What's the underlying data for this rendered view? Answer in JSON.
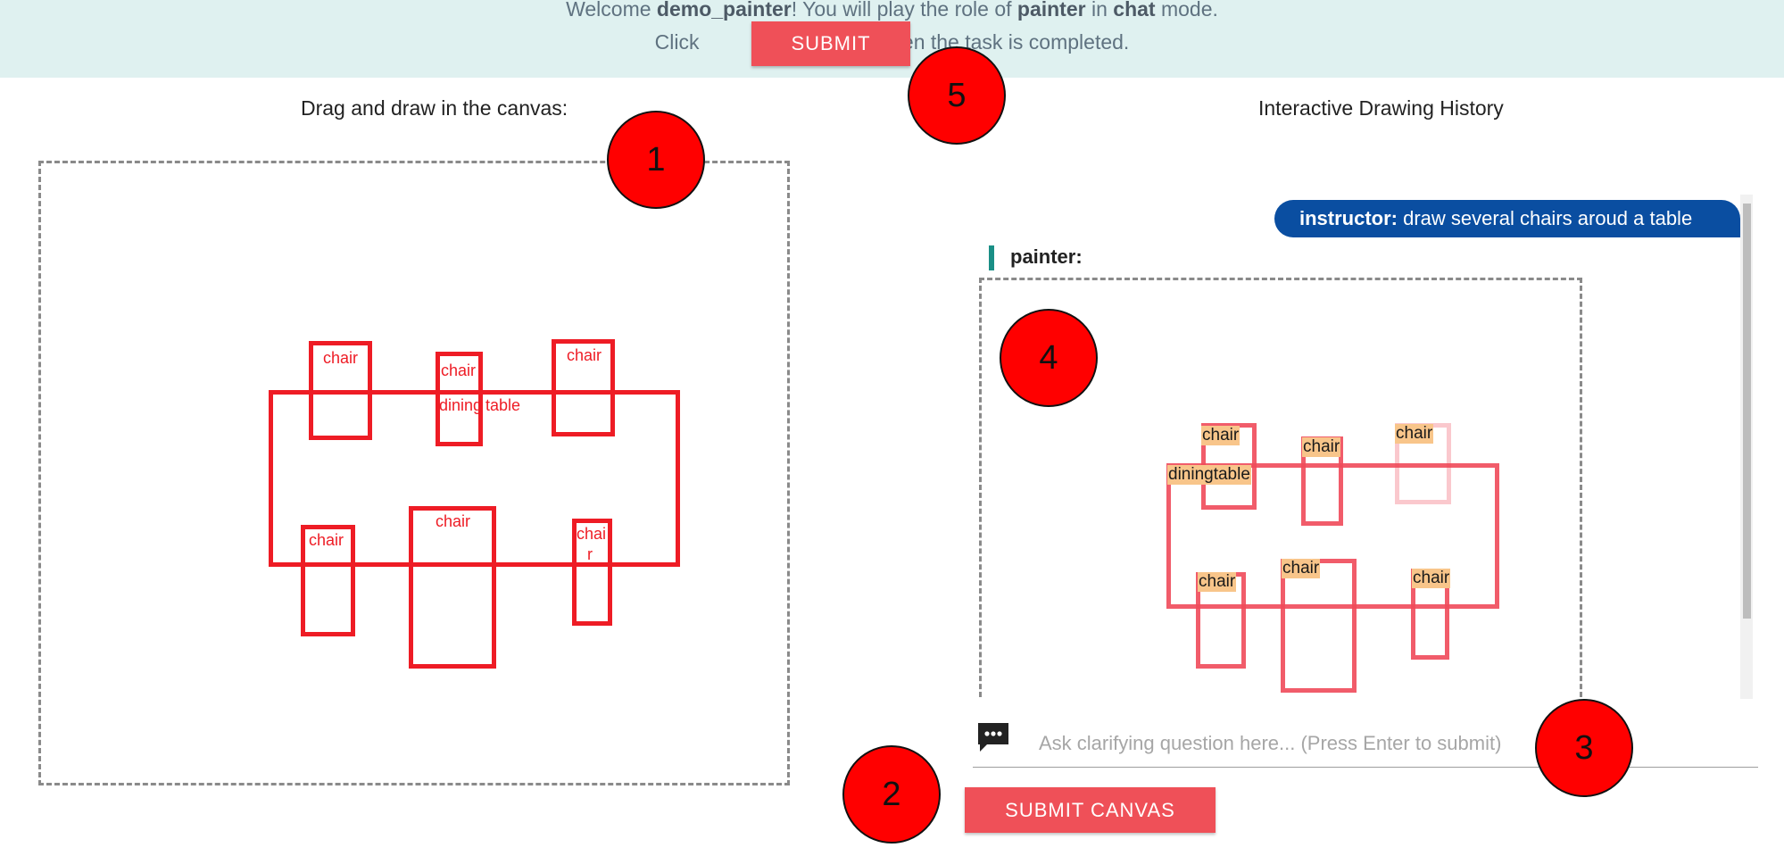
{
  "banner": {
    "welcome_prefix": "Welcome ",
    "username": "demo_painter",
    "role_prefix": "! You will play the role of ",
    "role": "painter",
    "mode_prefix": " in ",
    "mode": "chat",
    "mode_suffix": " mode.",
    "click_label": "Click",
    "submit_label": "SUBMIT",
    "completed_label": "when the task is completed."
  },
  "canvas": {
    "heading": "Drag and draw in the canvas:",
    "labels": [
      "chair",
      "chair",
      "dining",
      "table",
      "chair",
      "chair",
      "chair",
      "chai",
      "r"
    ]
  },
  "history": {
    "heading": "Interactive Drawing History",
    "instructor_name": "instructor:",
    "instructor_message": "draw several chairs aroud a table",
    "painter_name": "painter:",
    "labels": [
      "chair",
      "chair",
      "chair",
      "diningtable",
      "chair",
      "chair",
      "chair"
    ]
  },
  "chat_input": {
    "placeholder": "Ask clarifying question here... (Press Enter to submit)",
    "icon": "chat-bubble-icon"
  },
  "submit_canvas_label": "SUBMIT CANVAS",
  "markers": [
    "1",
    "2",
    "3",
    "4",
    "5"
  ],
  "colors": {
    "banner_bg": "#dff1f0",
    "button_red": "#ef5058",
    "draw_red": "#ee1c25",
    "instructor_bubble": "#0a4ea1",
    "label_highlight": "#f8c58a",
    "marker_red": "#ff0000"
  }
}
